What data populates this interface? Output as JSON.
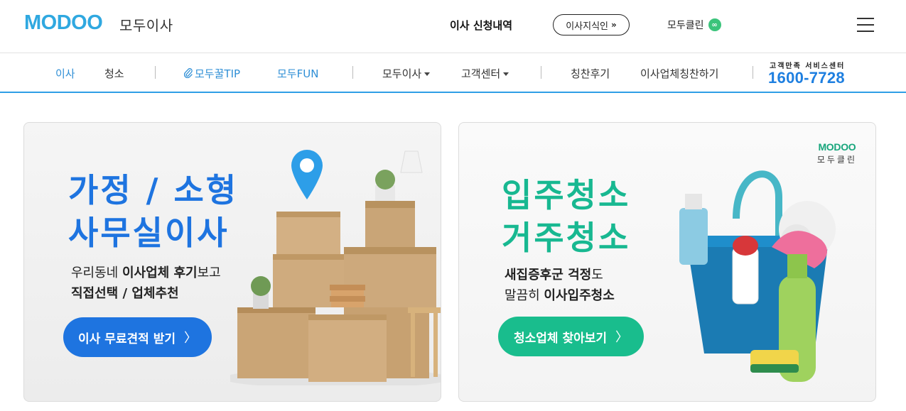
{
  "header": {
    "logo_text": "MODOO",
    "logo_sub": "모두이사",
    "move_history": "이사 신청내역",
    "knowledge_button": "이사지식인",
    "knowledge_chevron": "»",
    "clean_link": "모두클린",
    "clean_badge": "∞"
  },
  "nav": {
    "items": [
      {
        "label": "이사"
      },
      {
        "label": "청소"
      },
      {
        "label": "모두꿀TIP"
      },
      {
        "label": "모두FUN"
      },
      {
        "label": "모두이사"
      },
      {
        "label": "고객센터"
      },
      {
        "label": "칭찬후기"
      },
      {
        "label": "이사업체칭찬하기"
      }
    ],
    "cs_label": "고객만족 서비스센터",
    "cs_phone": "1600-7728"
  },
  "cards": {
    "moving": {
      "headline_1": "가정 / 소형",
      "headline_2": "사무실이사",
      "desc_1_pre": "우리동네 ",
      "desc_1_bold": "이사업체 후기",
      "desc_1_post": "보고",
      "desc_2": "직접선택 / 업체추천",
      "cta": "이사 무료견적 받기",
      "cta_arrow": "〉"
    },
    "cleaning": {
      "badge_word": "MODOO",
      "badge_sub": "모두클린",
      "headline_1": "입주청소",
      "headline_2": "거주청소",
      "desc_1_bold": "새집증후군 걱정",
      "desc_1_post": "도",
      "desc_2_pre": "말끔히 ",
      "desc_2_bold": "이사입주청소",
      "cta": "청소업체 찾아보기",
      "cta_arrow": "〉"
    }
  },
  "colors": {
    "brand_blue": "#2fa8e0",
    "primary_blue": "#1e74e0",
    "primary_green": "#19bd8d",
    "nav_underline": "#2f9fe6"
  }
}
